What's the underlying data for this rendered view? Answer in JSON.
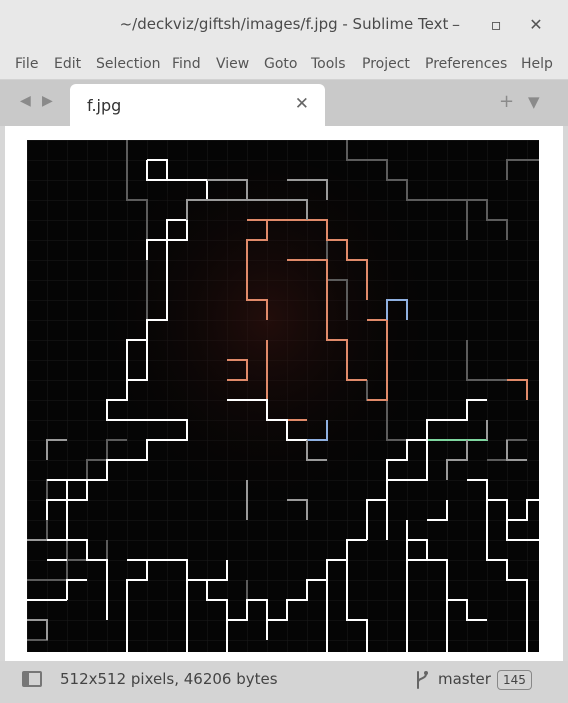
{
  "window": {
    "title": "~/deckviz/giftsh/images/f.jpg - Sublime Text",
    "minimize_symbol": "–",
    "maximize_symbol": "▫",
    "close_symbol": "✕"
  },
  "menu": {
    "items": [
      "File",
      "Edit",
      "Selection",
      "Find",
      "View",
      "Goto",
      "Tools",
      "Project",
      "Preferences",
      "Help"
    ]
  },
  "tabbar": {
    "back_symbol": "◀",
    "forward_symbol": "▶",
    "new_tab_symbol": "+",
    "tab_list_symbol": "▼"
  },
  "tab": {
    "label": "f.jpg",
    "close_symbol": "✕"
  },
  "image": {
    "description_colors": {
      "background": "#050505",
      "grid_bright": "#ffffff",
      "grid_dim": "#3a3a3a",
      "accent_warm": "#e08a6a",
      "accent_blue": "#8fb0e0",
      "accent_green": "#7fd6a0"
    }
  },
  "statusbar": {
    "info": "512x512 pixels, 46206 bytes",
    "branch": "master",
    "count": "145"
  },
  "icons": {
    "sidebar_toggle": "sidebar-toggle-icon",
    "branch": "git-branch-icon"
  }
}
